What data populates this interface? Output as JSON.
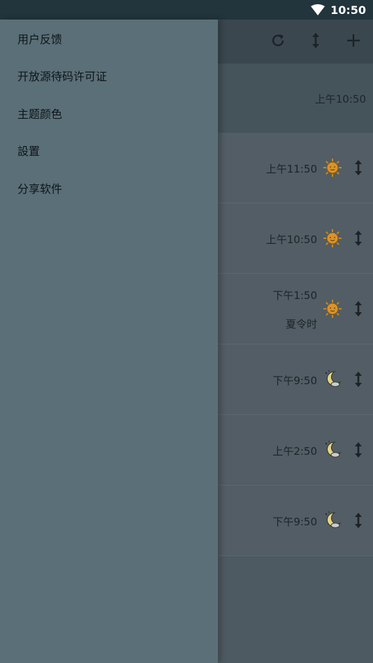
{
  "status_bar": {
    "time": "10:50",
    "wifi_icon": "wifi-icon"
  },
  "toolbar": {
    "refresh_icon": "refresh-icon",
    "reorder_icon": "reorder-icon",
    "add_icon": "add-icon"
  },
  "home": {
    "time": "上午10:50"
  },
  "cities": [
    {
      "time": "上午11:50",
      "dst": "",
      "icon": "sun-icon"
    },
    {
      "time": "上午10:50",
      "dst": "",
      "icon": "sun-icon"
    },
    {
      "time": "下午1:50",
      "dst": "夏令时",
      "icon": "sun-icon"
    },
    {
      "time": "下午9:50",
      "dst": "",
      "icon": "moon-icon"
    },
    {
      "time": "上午2:50",
      "dst": "",
      "icon": "moon-icon"
    },
    {
      "time": "下午9:50",
      "dst": "",
      "icon": "moon-icon"
    }
  ],
  "drawer": {
    "items": [
      {
        "label": "用户反馈"
      },
      {
        "label": "开放源待码许可证"
      },
      {
        "label": "主题颜色"
      },
      {
        "label": "設置"
      },
      {
        "label": "分享软件"
      }
    ]
  },
  "colors": {
    "drawer_bg": "#5a6f78",
    "status_bar_bg": "#22343c",
    "sun": "#e0a020",
    "moon": "#e8d890"
  }
}
